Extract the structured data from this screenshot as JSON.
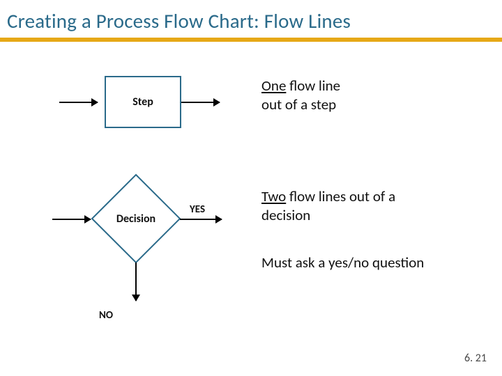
{
  "title": "Creating a Process Flow Chart: Flow Lines",
  "step_block": {
    "label": "Step",
    "desc_emph": "One",
    "desc_after": " flow line",
    "desc_line2": "out of a step"
  },
  "decision_block": {
    "label": "Decision",
    "yes_label": "YES",
    "no_label": "NO",
    "desc_emph": "Two",
    "desc_after": " flow lines out of a",
    "desc_line2": "decision",
    "rule": "Must ask a yes/no question"
  },
  "colors": {
    "accent": "#2a6a8a",
    "underline": "#e6a817"
  },
  "footer": "6. 21"
}
